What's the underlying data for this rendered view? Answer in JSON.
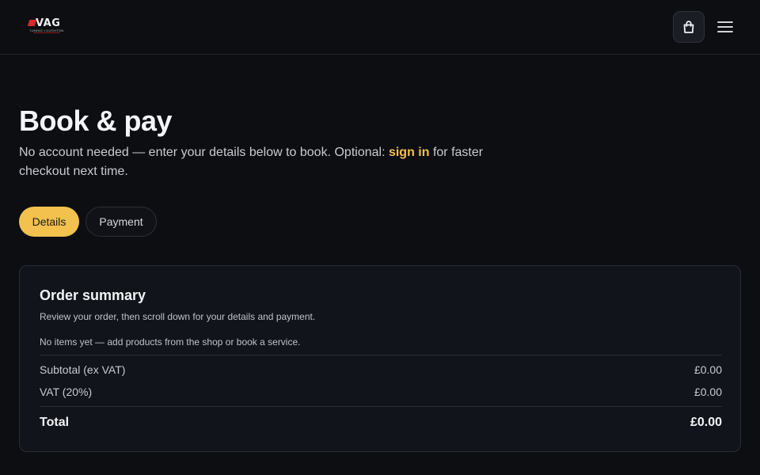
{
  "header": {
    "logo_text": "VAG",
    "logo_subtext": "TUNING LOUGHTON",
    "cart_icon": "shopping-bag-icon",
    "menu_icon": "hamburger-menu-icon"
  },
  "page": {
    "title": "Book & pay",
    "subtitle_before": "No account needed — enter your details below to book. Optional: ",
    "subtitle_link": "sign in",
    "subtitle_after": " for faster checkout next time."
  },
  "tabs": [
    {
      "label": "Details",
      "active": true
    },
    {
      "label": "Payment",
      "active": false
    }
  ],
  "order_summary": {
    "title": "Order summary",
    "hint": "Review your order, then scroll down for your details and payment.",
    "empty_message": "No items yet — add products from the shop or book a service.",
    "subtotal_label": "Subtotal (ex VAT)",
    "subtotal_value": "£0.00",
    "vat_label": "VAT (20%)",
    "vat_value": "£0.00",
    "total_label": "Total",
    "total_value": "£0.00"
  },
  "colors": {
    "accent": "#f2c14e",
    "background": "#0d0e12",
    "card": "#12141b",
    "logo_red": "#d62b2b"
  }
}
